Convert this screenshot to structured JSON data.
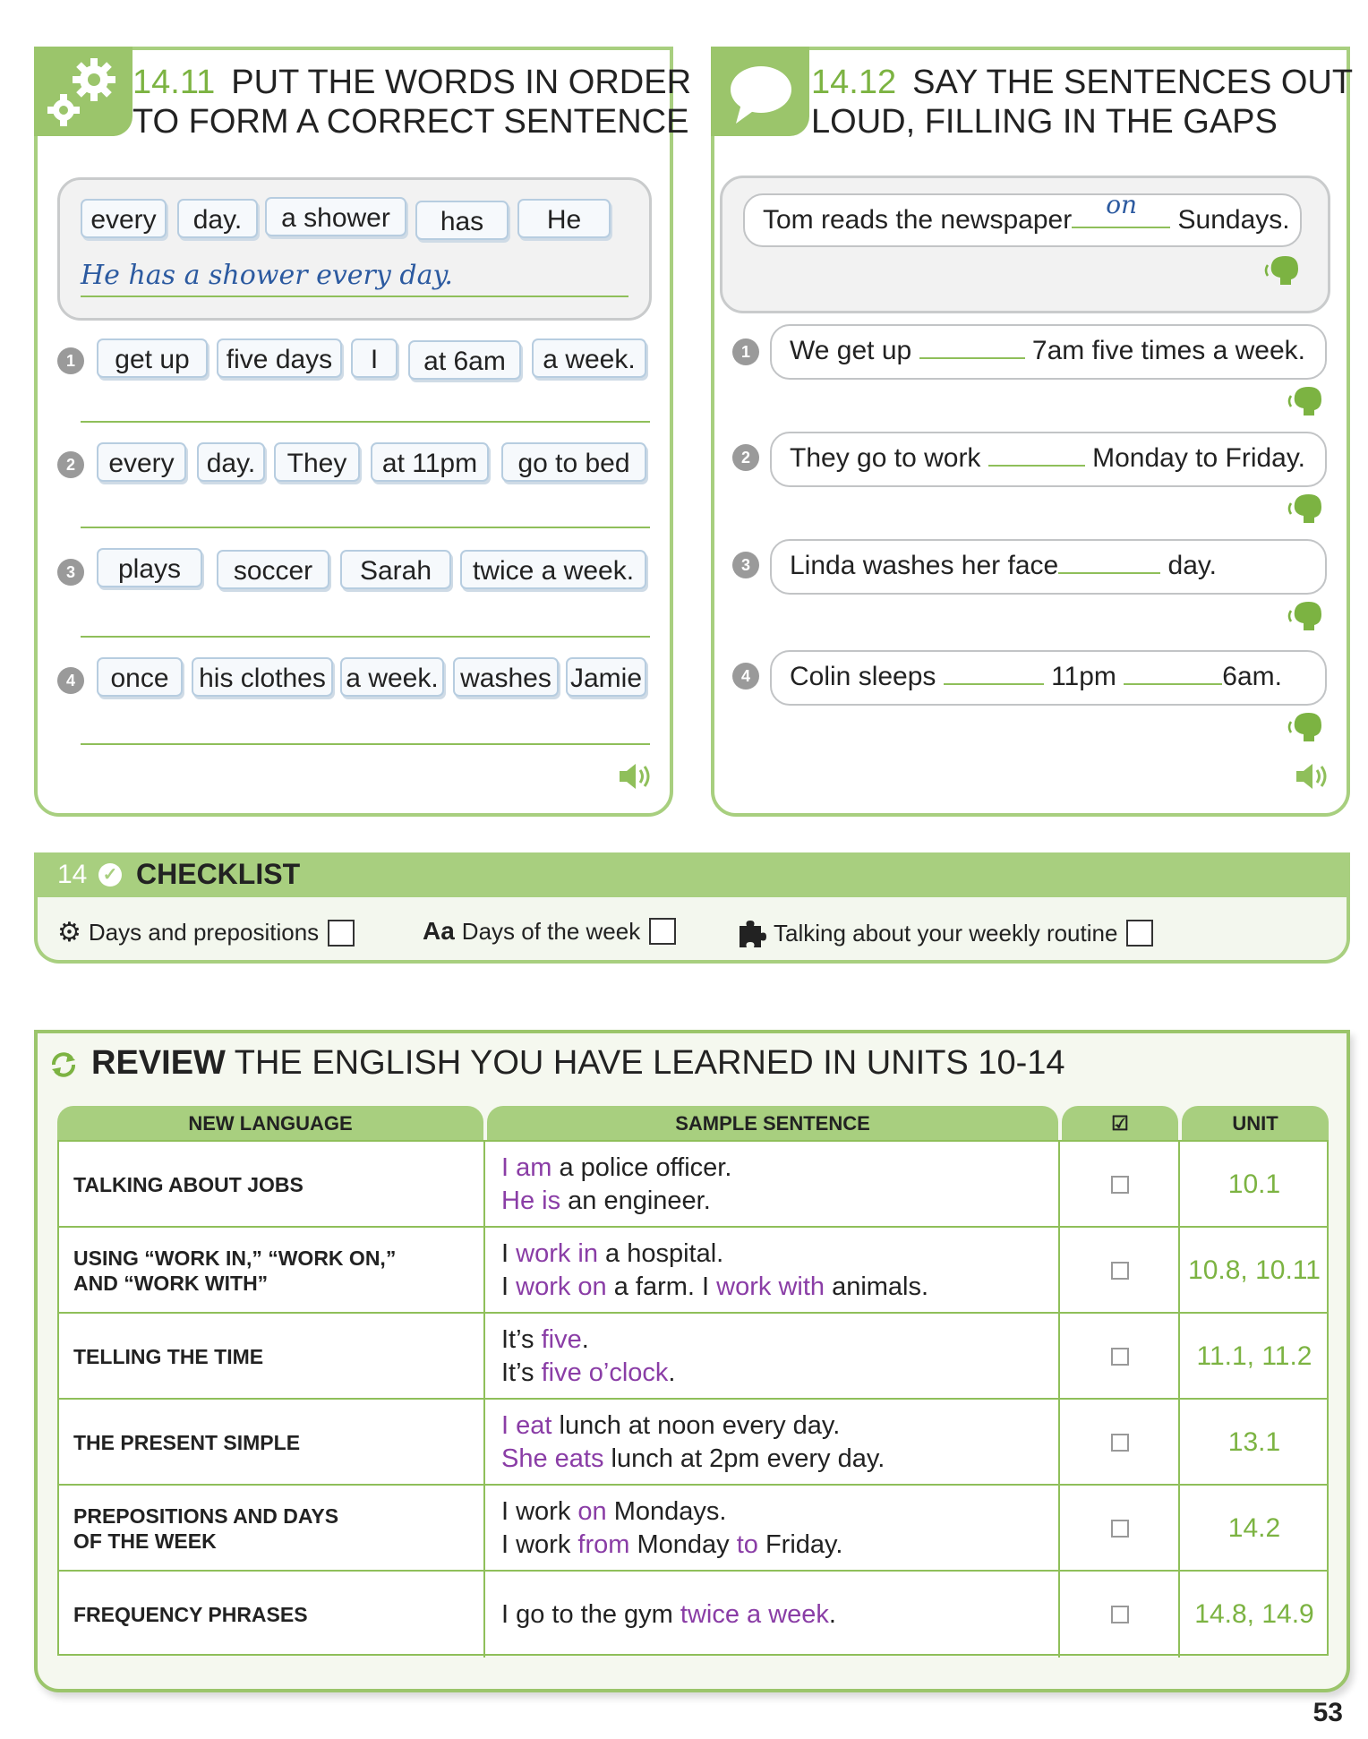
{
  "ex1": {
    "number": "14.11",
    "title_line1": "PUT THE WORDS IN ORDER",
    "title_line2": "TO FORM A CORRECT SENTENCE",
    "example_words": [
      "every",
      "day.",
      "a shower",
      "has",
      "He"
    ],
    "example_answer": "He has a shower every day.",
    "items": [
      {
        "num": "1",
        "words": [
          "get up",
          "five days",
          "I",
          "at 6am",
          "a week."
        ]
      },
      {
        "num": "2",
        "words": [
          "every",
          "day.",
          "They",
          "at 11pm",
          "go to bed"
        ]
      },
      {
        "num": "3",
        "words": [
          "plays",
          "soccer",
          "Sarah",
          "twice a week."
        ]
      },
      {
        "num": "4",
        "words": [
          "once",
          "his clothes",
          "a week.",
          "washes",
          "Jamie"
        ]
      }
    ]
  },
  "ex2": {
    "number": "14.12",
    "title_line1": "SAY THE SENTENCES OUT",
    "title_line2": "LOUD, FILLING IN THE GAPS",
    "example": {
      "before": "Tom reads the newspaper",
      "answer": "on",
      "after": "Sundays."
    },
    "items": [
      {
        "num": "1",
        "a": "We get up ",
        "b": " 7am five times a week."
      },
      {
        "num": "2",
        "a": "They go to work ",
        "b": " Monday to Friday."
      },
      {
        "num": "3",
        "a": "Linda washes her face",
        "b": " day."
      },
      {
        "num": "4",
        "a": "Colin sleeps ",
        "b": " 11pm ",
        "c": "6am."
      }
    ]
  },
  "checklist": {
    "number": "14",
    "title": "CHECKLIST",
    "items": [
      {
        "icon": "gears-icon",
        "label": "Days and prepositions"
      },
      {
        "icon_text": "Aa",
        "label": "Days of the week"
      },
      {
        "icon": "puzzle-icon",
        "label": "Talking about your weekly routine"
      }
    ]
  },
  "review": {
    "title_bold": "REVIEW",
    "title_rest": " THE ENGLISH YOU HAVE LEARNED IN UNITS 10-14",
    "columns": [
      "NEW LANGUAGE",
      "SAMPLE SENTENCE",
      "☑",
      "UNIT"
    ],
    "rows": [
      {
        "lang1": "TALKING ABOUT JOBS",
        "lang2": "",
        "s1": [
          [
            "I am",
            true
          ],
          [
            " a police officer.",
            false
          ]
        ],
        "s2": [
          [
            "He is",
            true
          ],
          [
            " an engineer.",
            false
          ]
        ],
        "unit": "10.1"
      },
      {
        "lang1": "USING “WORK IN,” “WORK ON,”",
        "lang2": "AND “WORK WITH”",
        "s1": [
          [
            "I ",
            false
          ],
          [
            "work in",
            true
          ],
          [
            " a hospital.",
            false
          ]
        ],
        "s2": [
          [
            "I ",
            false
          ],
          [
            "work on",
            true
          ],
          [
            " a farm. I ",
            false
          ],
          [
            "work with",
            true
          ],
          [
            " animals.",
            false
          ]
        ],
        "unit": "10.8, 10.11"
      },
      {
        "lang1": "TELLING THE TIME",
        "lang2": "",
        "s1": [
          [
            "It’s ",
            false
          ],
          [
            "five",
            true
          ],
          [
            ".",
            false
          ]
        ],
        "s2": [
          [
            "It’s ",
            false
          ],
          [
            "five o’clock",
            true
          ],
          [
            ".",
            false
          ]
        ],
        "unit": "11.1, 11.2"
      },
      {
        "lang1": "THE PRESENT SIMPLE",
        "lang2": "",
        "s1": [
          [
            "I eat",
            true
          ],
          [
            " lunch at noon every day.",
            false
          ]
        ],
        "s2": [
          [
            "She eats",
            true
          ],
          [
            " lunch at 2pm every day.",
            false
          ]
        ],
        "unit": "13.1"
      },
      {
        "lang1": "PREPOSITIONS AND DAYS",
        "lang2": "OF THE WEEK",
        "s1": [
          [
            "I work ",
            false
          ],
          [
            "on",
            true
          ],
          [
            " Mondays.",
            false
          ]
        ],
        "s2": [
          [
            "I work ",
            false
          ],
          [
            "from",
            true
          ],
          [
            " Monday ",
            false
          ],
          [
            "to",
            true
          ],
          [
            " Friday.",
            false
          ]
        ],
        "unit": "14.2"
      },
      {
        "lang1": "FREQUENCY PHRASES",
        "lang2": "",
        "s1": [
          [
            "I go to the gym ",
            false
          ],
          [
            "twice a week",
            true
          ],
          [
            ".",
            false
          ]
        ],
        "s2": [],
        "unit": "14.8, 14.9"
      }
    ]
  },
  "page_number": "53"
}
